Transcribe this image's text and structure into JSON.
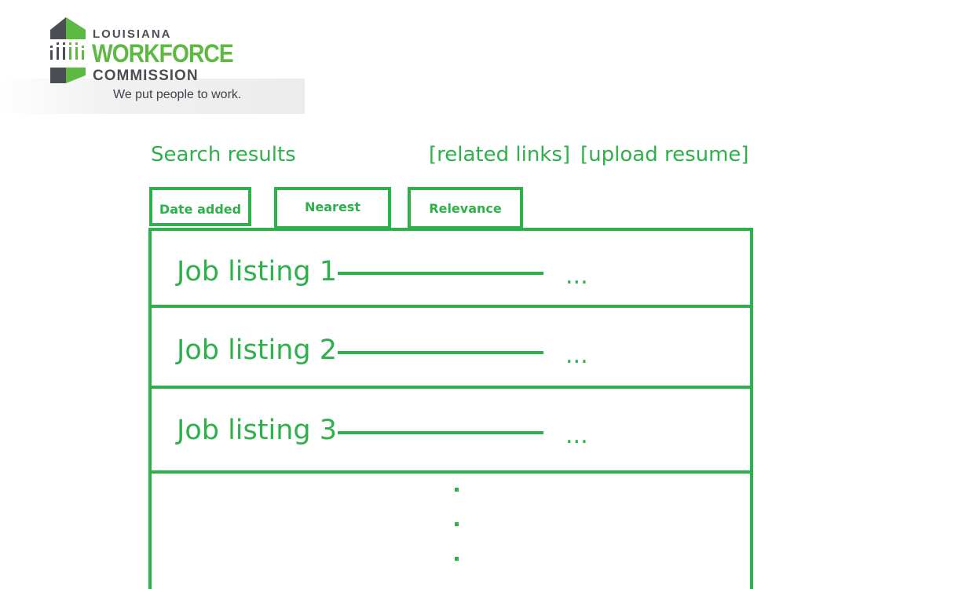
{
  "logo": {
    "line1": "LOUISIANA",
    "line2": "WORKFORCE",
    "line3": "COMMISSION",
    "tagline": "We put people to work.",
    "colors": {
      "green": "#5db942",
      "gray": "#4b4f55"
    }
  },
  "header": {
    "title": "Search results",
    "links": [
      "[related links]",
      "[upload resume]"
    ]
  },
  "sort_tabs": [
    "Date added",
    "Nearest",
    "Relevance"
  ],
  "results": {
    "listings": [
      {
        "title": "Job listing 1",
        "more": "..."
      },
      {
        "title": "Job listing 2",
        "more": "..."
      },
      {
        "title": "Job listing 3",
        "more": "..."
      }
    ],
    "more_indicator": "..."
  },
  "colors": {
    "accent": "#2eb04b",
    "background": "#ffffff"
  }
}
